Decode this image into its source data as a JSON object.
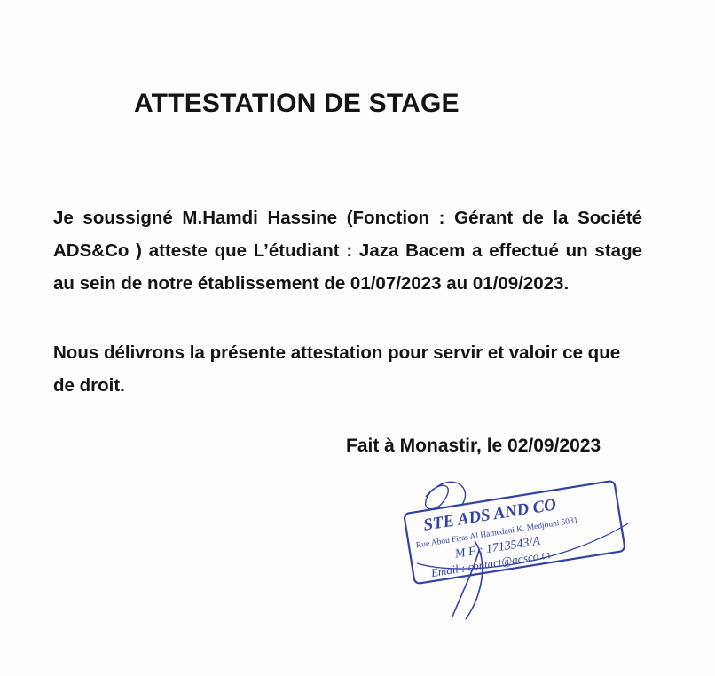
{
  "document": {
    "title": "ATTESTATION DE STAGE",
    "paragraph1": "Je soussigné M.Hamdi Hassine (Fonction : Gérant de la Société ADS&Co ) atteste que L’étudiant : Jaza Bacem a effectué un stage au sein de notre établissement de 01/07/2023 au 01/09/2023.",
    "paragraph2": "Nous délivrons la présente attestation pour servir et valoir ce que de droit.",
    "place_date": "Fait à Monastir, le 02/09/2023"
  },
  "stamp": {
    "company": "STE ADS AND CO",
    "address": "Rue Abou Firas Al Hamedani K. Medjouni 5031",
    "mf": "M F : 1713543/A",
    "email": "Email : contact@adsco.tn",
    "ink_color": "#3342a6"
  }
}
